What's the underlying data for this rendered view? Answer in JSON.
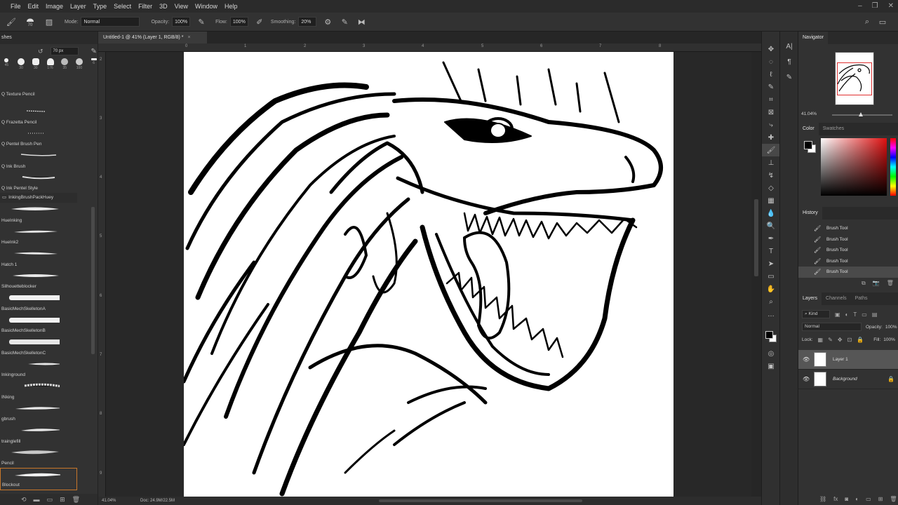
{
  "menu": [
    "File",
    "Edit",
    "Image",
    "Layer",
    "Type",
    "Select",
    "Filter",
    "3D",
    "View",
    "Window",
    "Help"
  ],
  "options": {
    "mode_label": "Mode:",
    "mode_value": "Normal",
    "opacity_label": "Opacity:",
    "opacity_value": "100%",
    "flow_label": "Flow:",
    "flow_value": "100%",
    "smoothing_label": "Smoothing:",
    "smoothing_value": "20%",
    "brush_size": "70"
  },
  "brushes_panel": {
    "title": "shes",
    "size_value": "70 px",
    "tip_sizes": [
      "45",
      "30",
      "30",
      "176",
      "35",
      "100",
      "6"
    ],
    "group_name": "InkingBrushPackHuey",
    "items_before_group": [
      "Q Texture Pencil",
      "Q Frazetta Pencil",
      "Q Pentel Brush Pen",
      "Q Ink Brush",
      "Q Ink Pentel Style"
    ],
    "items_after_group": [
      "HueInking",
      "HueInk2",
      "Hatch 1",
      "Silhouetteblocker",
      "BasicMechSkelletonA",
      "BasicMechSkelletonB",
      "BasicMechSkelletonC",
      "Inkinground",
      "INking",
      "gbrush",
      "trainglefill",
      "Pencil",
      "Blockout"
    ],
    "selected": "Blockout"
  },
  "document": {
    "tab_title": "Untitled-1 @ 41% (Layer 1, RGB/8) *",
    "ruler_h": [
      "0",
      "1",
      "2",
      "3",
      "4",
      "5",
      "6",
      "7",
      "8"
    ],
    "ruler_v": [
      "2",
      "3",
      "4",
      "5",
      "6",
      "7",
      "8",
      "9"
    ],
    "status_zoom": "41.04%",
    "status_doc": "Doc: 24.9M/22.5M"
  },
  "navigator": {
    "title": "Navigator",
    "zoom": "41.04%"
  },
  "color": {
    "tab_color": "Color",
    "tab_swatches": "Swatches",
    "foreground": "#000000",
    "background": "#ffffff",
    "hue": "#e01010"
  },
  "history": {
    "title": "History",
    "items": [
      "Brush Tool",
      "Brush Tool",
      "Brush Tool",
      "Brush Tool",
      "Brush Tool"
    ]
  },
  "layers": {
    "tabs": [
      "Layers",
      "Channels",
      "Paths"
    ],
    "filter_kind": "Kind",
    "blend_mode": "Normal",
    "opacity_label": "Opacity:",
    "opacity_value": "100%",
    "lock_label": "Lock:",
    "fill_label": "Fill:",
    "fill_value": "100%",
    "items": [
      {
        "name": "Layer 1",
        "selected": true
      },
      {
        "name": "Background",
        "selected": false
      }
    ]
  },
  "icons": {
    "tools": [
      "move-icon",
      "marquee-icon",
      "lasso-icon",
      "quick-select-icon",
      "crop-icon",
      "frame-icon",
      "eyedropper-icon",
      "healing-icon",
      "brush-icon",
      "stamp-icon",
      "history-brush-icon",
      "eraser-icon",
      "gradient-icon",
      "blur-icon",
      "dodge-icon",
      "pen-icon",
      "type-icon",
      "path-select-icon",
      "shape-icon",
      "hand-icon",
      "zoom-icon",
      "more-icon"
    ]
  }
}
